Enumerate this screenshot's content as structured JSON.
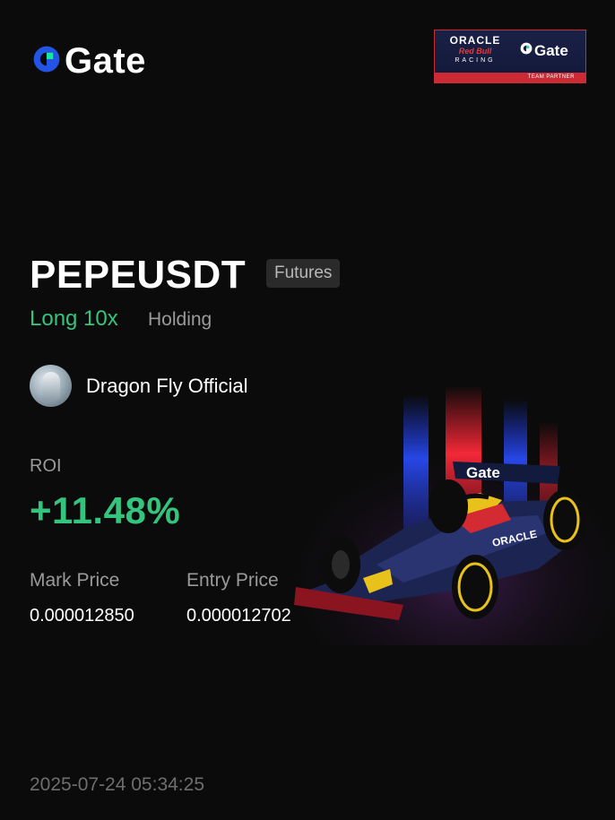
{
  "brand": {
    "name": "Gate",
    "logo_icon": "gate-logo-icon",
    "accent": "#2354e6",
    "accent2": "#17e6a1"
  },
  "partner": {
    "oracle": "ORACLE",
    "redbull": "Red Bull",
    "racing": "RACING",
    "brand": "Gate",
    "subtitle": "TEAM PARTNER"
  },
  "position": {
    "pair": "PEPEUSDT",
    "market_tag": "Futures",
    "side": "Long 10x",
    "status": "Holding"
  },
  "user": {
    "name": "Dragon Fly Official"
  },
  "roi": {
    "label": "ROI",
    "value": "+11.48%"
  },
  "prices": {
    "mark_label": "Mark Price",
    "mark_value": "0.000012850",
    "entry_label": "Entry Price",
    "entry_value": "0.000012702"
  },
  "timestamp": "2025-07-24 05:34:25",
  "colors": {
    "background": "#0b0b0b",
    "profit_green": "#35c47e",
    "muted": "#9a9a9a"
  }
}
